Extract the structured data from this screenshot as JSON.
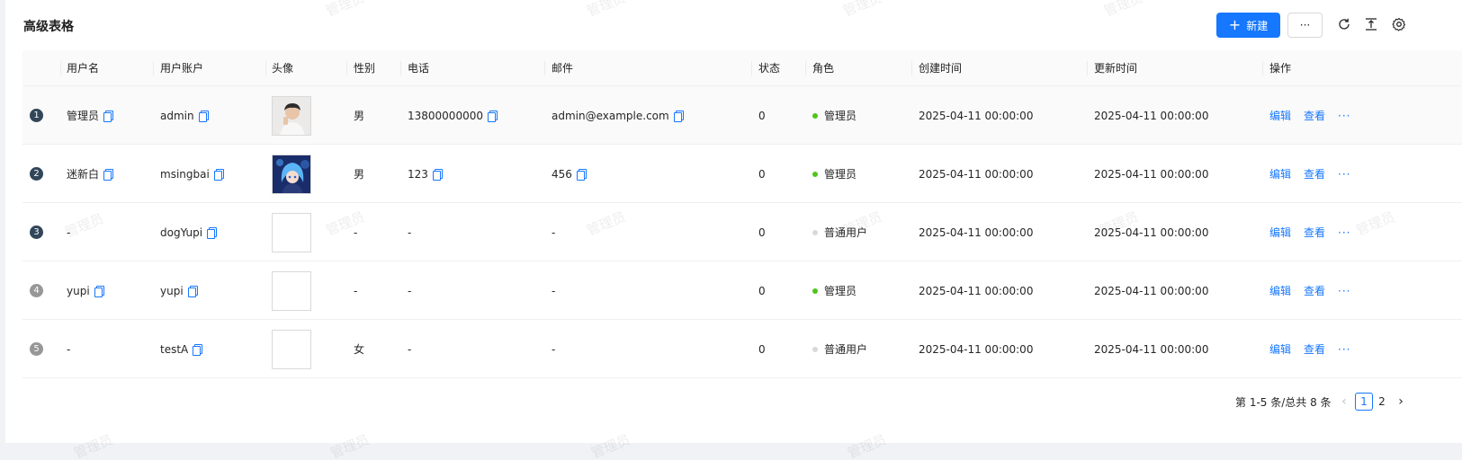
{
  "page": {
    "title": "高级表格"
  },
  "watermark": "管理员",
  "toolbar": {
    "new_label": "新建",
    "more_label": "···",
    "icons": [
      "reload-icon",
      "density-icon",
      "settings-icon"
    ]
  },
  "table": {
    "columns": [
      "用户名",
      "用户账户",
      "头像",
      "性别",
      "电话",
      "邮件",
      "状态",
      "角色",
      "创建时间",
      "更新时间",
      "操作"
    ],
    "rows": [
      {
        "index": "1",
        "username": "管理员",
        "account": "admin",
        "avatar": "photo-man",
        "gender": "男",
        "phone": "13800000000",
        "email": "admin@example.com",
        "status": "0",
        "role": "管理员",
        "role_color": "#52c41a",
        "created": "2025-04-11 00:00:00",
        "updated": "2025-04-11 00:00:00"
      },
      {
        "index": "2",
        "username": "迷新白",
        "account": "msingbai",
        "avatar": "photo-anime",
        "gender": "男",
        "phone": "123",
        "email": "456",
        "status": "0",
        "role": "管理员",
        "role_color": "#52c41a",
        "created": "2025-04-11 00:00:00",
        "updated": "2025-04-11 00:00:00"
      },
      {
        "index": "3",
        "username": "-",
        "account": "dogYupi",
        "avatar": "empty",
        "gender": "-",
        "phone": "-",
        "email": "-",
        "status": "0",
        "role": "普通用户",
        "role_color": "#d9d9d9",
        "created": "2025-04-11 00:00:00",
        "updated": "2025-04-11 00:00:00"
      },
      {
        "index": "4",
        "username": "yupi",
        "account": "yupi",
        "avatar": "empty",
        "gender": "-",
        "phone": "-",
        "email": "-",
        "status": "0",
        "role": "管理员",
        "role_color": "#52c41a",
        "created": "2025-04-11 00:00:00",
        "updated": "2025-04-11 00:00:00"
      },
      {
        "index": "5",
        "username": "-",
        "account": "testA",
        "avatar": "empty",
        "gender": "女",
        "phone": "-",
        "email": "-",
        "status": "0",
        "role": "普通用户",
        "role_color": "#d9d9d9",
        "created": "2025-04-11 00:00:00",
        "updated": "2025-04-11 00:00:00"
      }
    ],
    "action_edit": "编辑",
    "action_view": "查看",
    "action_more": "···"
  },
  "pagination": {
    "summary": "第 1-5 条/总共 8 条",
    "pages": [
      "1",
      "2"
    ],
    "current": "1",
    "prev": "‹",
    "next": "›"
  },
  "colors": {
    "primary": "#1677ff",
    "index_dark": "#314659",
    "index_light": "#979797"
  }
}
